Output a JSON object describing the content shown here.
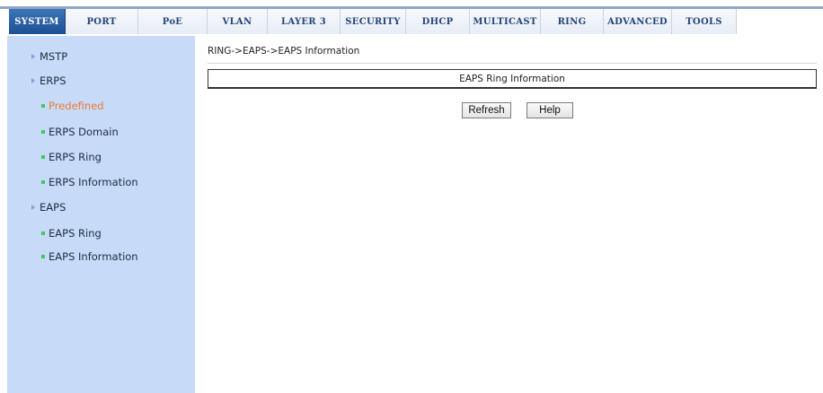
{
  "tabs": [
    {
      "label": "SYSTEM",
      "active": true
    },
    {
      "label": "PORT",
      "active": false
    },
    {
      "label": "PoE",
      "active": false
    },
    {
      "label": "VLAN",
      "active": false
    },
    {
      "label": "LAYER 3",
      "active": false
    },
    {
      "label": "SECURITY",
      "active": false
    },
    {
      "label": "DHCP",
      "active": false
    },
    {
      "label": "MULTICAST",
      "active": false
    },
    {
      "label": "RING",
      "active": false
    },
    {
      "label": "ADVANCED",
      "active": false
    },
    {
      "label": "TOOLS",
      "active": false
    }
  ],
  "sidebar": {
    "items": [
      {
        "label": "MSTP",
        "level": 1
      },
      {
        "label": "ERPS",
        "level": 1
      },
      {
        "label": "Predefined",
        "level": 2,
        "selected": true
      },
      {
        "label": "ERPS Domain",
        "level": 2
      },
      {
        "label": "ERPS Ring",
        "level": 2
      },
      {
        "label": "ERPS Information",
        "level": 2
      },
      {
        "label": "EAPS",
        "level": 1
      },
      {
        "label": "EAPS Ring",
        "level": 2
      },
      {
        "label": "EAPS Information",
        "level": 2
      }
    ]
  },
  "main": {
    "breadcrumb": "RING->EAPS->EAPS Information",
    "table_header": "EAPS Ring Information",
    "refresh_label": "Refresh",
    "help_label": "Help"
  },
  "colors": {
    "tab_active": "#2a5fa5",
    "tab_text": "#24457c",
    "sidebar_bg": "#c7daf7",
    "selected_item": "#f07a3a",
    "bullet_green": "#41c864",
    "triangle": "#7fa3d8"
  }
}
